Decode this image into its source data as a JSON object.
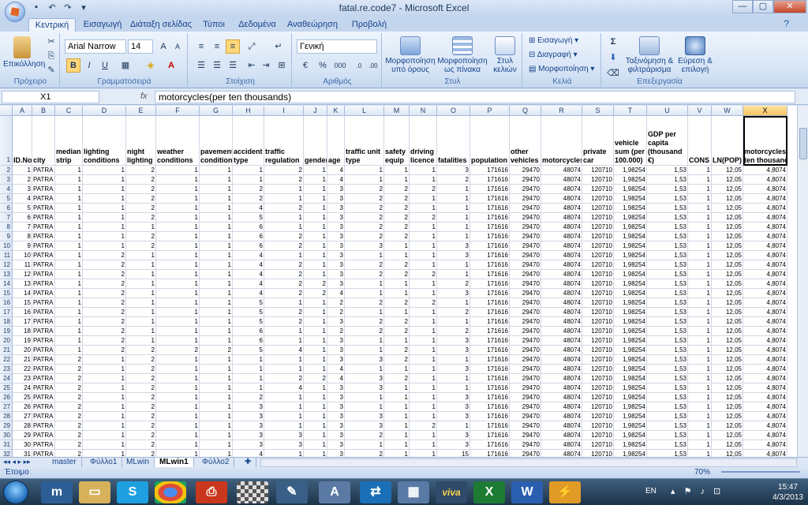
{
  "window": {
    "title": "fatal.re.code7 - Microsoft Excel",
    "minimize": "—",
    "maximize": "▢",
    "close": "✕"
  },
  "tabs": [
    "Κεντρική",
    "Εισαγωγή",
    "Διάταξη σελίδας",
    "Τύποι",
    "Δεδομένα",
    "Αναθεώρηση",
    "Προβολή"
  ],
  "ribbon": {
    "clipboard": {
      "paste": "Επικόλληση",
      "label": "Πρόχειρο"
    },
    "font": {
      "name": "Arial Narrow",
      "size": "14",
      "label": "Γραμματοσειρά",
      "bold": "B",
      "italic": "I",
      "underline": "U"
    },
    "alignment": {
      "label": "Στοίχιση"
    },
    "number": {
      "format": "Γενική",
      "label": "Αριθμός",
      "percent": "%",
      "thousands": "000"
    },
    "styles": {
      "conditional": "Μορφοποίηση υπό όρους",
      "table": "Μορφοποίηση ως πίνακα",
      "cell": "Στυλ κελιών",
      "label": "Στυλ"
    },
    "cells": {
      "insert": "Εισαγωγή",
      "delete": "Διαγραφή",
      "format": "Μορφοποίηση",
      "label": "Κελιά"
    },
    "editing": {
      "sort": "Ταξινόμηση & φιλτράρισμα",
      "find": "Εύρεση & επιλογή",
      "label": "Επεξεργασία"
    }
  },
  "formula_bar": {
    "name_box": "X1",
    "fx": "fx",
    "content": "motorcycles(per ten thousands)"
  },
  "columns": [
    "A",
    "B",
    "C",
    "D",
    "E",
    "F",
    "G",
    "H",
    "I",
    "J",
    "K",
    "L",
    "M",
    "N",
    "O",
    "P",
    "Q",
    "R",
    "S",
    "T",
    "U",
    "V",
    "W",
    "X"
  ],
  "headers": [
    "ID.No",
    "city",
    "median strip",
    "lighting conditions",
    "night lighting",
    "weather conditions",
    "pavement condition",
    "accident type",
    "traffic regulation",
    "gender",
    "age",
    "traffic unit type",
    "safety equip",
    "driving licence",
    "fatalities",
    "population",
    "other vehicles",
    "motorcycles",
    "private car",
    "vehicle sum (per 100.000)",
    "GDP per capita (thousand €)",
    "CONS",
    "LN(POP)",
    "motorcycles(per ten thousands)"
  ],
  "rows": [
    [
      "1",
      "PATRA",
      "1",
      "1",
      "2",
      "1",
      "1",
      "1",
      "2",
      "1",
      "4",
      "1",
      "1",
      "1",
      "3",
      "171616",
      "29470",
      "48074",
      "120710",
      "1,98254",
      "1,53",
      "1",
      "12,05",
      "4,8074"
    ],
    [
      "2",
      "PATRA",
      "1",
      "1",
      "2",
      "1",
      "1",
      "1",
      "2",
      "1",
      "4",
      "1",
      "1",
      "1",
      "2",
      "171616",
      "29470",
      "48074",
      "120710",
      "1,98254",
      "1,53",
      "1",
      "12,05",
      "4,8074"
    ],
    [
      "3",
      "PATRA",
      "1",
      "1",
      "2",
      "1",
      "1",
      "2",
      "1",
      "1",
      "3",
      "2",
      "2",
      "2",
      "1",
      "171616",
      "29470",
      "48074",
      "120710",
      "1,98254",
      "1,53",
      "1",
      "12,05",
      "4,8074"
    ],
    [
      "4",
      "PATRA",
      "1",
      "1",
      "2",
      "1",
      "1",
      "2",
      "1",
      "1",
      "3",
      "2",
      "2",
      "1",
      "1",
      "171616",
      "29470",
      "48074",
      "120710",
      "1,98254",
      "1,53",
      "1",
      "12,05",
      "4,8074"
    ],
    [
      "5",
      "PATRA",
      "1",
      "1",
      "2",
      "1",
      "1",
      "4",
      "2",
      "1",
      "3",
      "2",
      "2",
      "1",
      "1",
      "171616",
      "29470",
      "48074",
      "120710",
      "1,98254",
      "1,53",
      "1",
      "12,05",
      "4,8074"
    ],
    [
      "6",
      "PATRA",
      "1",
      "1",
      "2",
      "1",
      "1",
      "5",
      "1",
      "1",
      "3",
      "2",
      "2",
      "2",
      "1",
      "171616",
      "29470",
      "48074",
      "120710",
      "1,98254",
      "1,53",
      "1",
      "12,05",
      "4,8074"
    ],
    [
      "7",
      "PATRA",
      "1",
      "1",
      "1",
      "1",
      "1",
      "6",
      "1",
      "1",
      "3",
      "2",
      "2",
      "1",
      "1",
      "171616",
      "29470",
      "48074",
      "120710",
      "1,98254",
      "1,53",
      "1",
      "12,05",
      "4,8074"
    ],
    [
      "8",
      "PATRA",
      "1",
      "1",
      "2",
      "1",
      "1",
      "6",
      "2",
      "1",
      "3",
      "2",
      "2",
      "1",
      "1",
      "171616",
      "29470",
      "48074",
      "120710",
      "1,98254",
      "1,53",
      "1",
      "12,05",
      "4,8074"
    ],
    [
      "9",
      "PATRA",
      "1",
      "1",
      "2",
      "1",
      "1",
      "6",
      "2",
      "1",
      "3",
      "3",
      "1",
      "1",
      "3",
      "171616",
      "29470",
      "48074",
      "120710",
      "1,98254",
      "1,53",
      "1",
      "12,05",
      "4,8074"
    ],
    [
      "10",
      "PATRA",
      "1",
      "2",
      "1",
      "1",
      "1",
      "4",
      "1",
      "1",
      "3",
      "1",
      "1",
      "1",
      "3",
      "171616",
      "29470",
      "48074",
      "120710",
      "1,98254",
      "1,53",
      "1",
      "12,05",
      "4,8074"
    ],
    [
      "11",
      "PATRA",
      "1",
      "2",
      "1",
      "1",
      "1",
      "4",
      "2",
      "1",
      "3",
      "2",
      "2",
      "1",
      "1",
      "171616",
      "29470",
      "48074",
      "120710",
      "1,98254",
      "1,53",
      "1",
      "12,05",
      "4,8074"
    ],
    [
      "12",
      "PATRA",
      "1",
      "2",
      "1",
      "1",
      "1",
      "4",
      "2",
      "1",
      "3",
      "2",
      "2",
      "2",
      "1",
      "171616",
      "29470",
      "48074",
      "120710",
      "1,98254",
      "1,53",
      "1",
      "12,05",
      "4,8074"
    ],
    [
      "13",
      "PATRA",
      "1",
      "2",
      "1",
      "1",
      "1",
      "4",
      "2",
      "2",
      "3",
      "1",
      "1",
      "1",
      "2",
      "171616",
      "29470",
      "48074",
      "120710",
      "1,98254",
      "1,53",
      "1",
      "12,05",
      "4,8074"
    ],
    [
      "14",
      "PATRA",
      "1",
      "2",
      "1",
      "1",
      "1",
      "4",
      "2",
      "2",
      "4",
      "1",
      "1",
      "1",
      "3",
      "171616",
      "29470",
      "48074",
      "120710",
      "1,98254",
      "1,53",
      "1",
      "12,05",
      "4,8074"
    ],
    [
      "15",
      "PATRA",
      "1",
      "2",
      "1",
      "1",
      "1",
      "5",
      "1",
      "1",
      "2",
      "2",
      "2",
      "2",
      "1",
      "171616",
      "29470",
      "48074",
      "120710",
      "1,98254",
      "1,53",
      "1",
      "12,05",
      "4,8074"
    ],
    [
      "16",
      "PATRA",
      "1",
      "2",
      "1",
      "1",
      "1",
      "5",
      "2",
      "1",
      "2",
      "1",
      "1",
      "1",
      "2",
      "171616",
      "29470",
      "48074",
      "120710",
      "1,98254",
      "1,53",
      "1",
      "12,05",
      "4,8074"
    ],
    [
      "17",
      "PATRA",
      "1",
      "2",
      "1",
      "1",
      "1",
      "5",
      "2",
      "1",
      "3",
      "2",
      "2",
      "1",
      "1",
      "171616",
      "29470",
      "48074",
      "120710",
      "1,98254",
      "1,53",
      "1",
      "12,05",
      "4,8074"
    ],
    [
      "18",
      "PATRA",
      "1",
      "2",
      "1",
      "1",
      "1",
      "6",
      "1",
      "1",
      "2",
      "2",
      "2",
      "1",
      "2",
      "171616",
      "29470",
      "48074",
      "120710",
      "1,98254",
      "1,53",
      "1",
      "12,05",
      "4,8074"
    ],
    [
      "19",
      "PATRA",
      "1",
      "2",
      "1",
      "1",
      "1",
      "6",
      "1",
      "1",
      "3",
      "1",
      "1",
      "1",
      "3",
      "171616",
      "29470",
      "48074",
      "120710",
      "1,98254",
      "1,53",
      "1",
      "12,05",
      "4,8074"
    ],
    [
      "20",
      "PATRA",
      "1",
      "2",
      "2",
      "2",
      "2",
      "5",
      "4",
      "1",
      "3",
      "1",
      "2",
      "1",
      "3",
      "171616",
      "29470",
      "48074",
      "120710",
      "1,98254",
      "1,53",
      "1",
      "12,05",
      "4,8074"
    ],
    [
      "21",
      "PATRA",
      "2",
      "1",
      "2",
      "1",
      "1",
      "1",
      "1",
      "1",
      "3",
      "3",
      "2",
      "1",
      "1",
      "171616",
      "29470",
      "48074",
      "120710",
      "1,98254",
      "1,53",
      "1",
      "12,05",
      "4,8074"
    ],
    [
      "22",
      "PATRA",
      "2",
      "1",
      "2",
      "1",
      "1",
      "1",
      "1",
      "1",
      "4",
      "1",
      "1",
      "1",
      "3",
      "171616",
      "29470",
      "48074",
      "120710",
      "1,98254",
      "1,53",
      "1",
      "12,05",
      "4,8074"
    ],
    [
      "23",
      "PATRA",
      "2",
      "1",
      "2",
      "1",
      "1",
      "1",
      "2",
      "2",
      "4",
      "3",
      "2",
      "1",
      "1",
      "171616",
      "29470",
      "48074",
      "120710",
      "1,98254",
      "1,53",
      "1",
      "12,05",
      "4,8074"
    ],
    [
      "24",
      "PATRA",
      "2",
      "1",
      "2",
      "1",
      "1",
      "1",
      "4",
      "1",
      "3",
      "3",
      "1",
      "1",
      "1",
      "171616",
      "29470",
      "48074",
      "120710",
      "1,98254",
      "1,53",
      "1",
      "12,05",
      "4,8074"
    ],
    [
      "25",
      "PATRA",
      "2",
      "1",
      "2",
      "1",
      "1",
      "2",
      "1",
      "1",
      "3",
      "1",
      "1",
      "1",
      "3",
      "171616",
      "29470",
      "48074",
      "120710",
      "1,98254",
      "1,53",
      "1",
      "12,05",
      "4,8074"
    ],
    [
      "26",
      "PATRA",
      "2",
      "1",
      "2",
      "1",
      "1",
      "3",
      "1",
      "1",
      "3",
      "1",
      "1",
      "1",
      "3",
      "171616",
      "29470",
      "48074",
      "120710",
      "1,98254",
      "1,53",
      "1",
      "12,05",
      "4,8074"
    ],
    [
      "27",
      "PATRA",
      "2",
      "1",
      "2",
      "1",
      "1",
      "3",
      "1",
      "1",
      "3",
      "3",
      "1",
      "1",
      "3",
      "171616",
      "29470",
      "48074",
      "120710",
      "1,98254",
      "1,53",
      "1",
      "12,05",
      "4,8074"
    ],
    [
      "28",
      "PATRA",
      "2",
      "1",
      "2",
      "1",
      "1",
      "3",
      "1",
      "1",
      "3",
      "3",
      "1",
      "2",
      "1",
      "171616",
      "29470",
      "48074",
      "120710",
      "1,98254",
      "1,53",
      "1",
      "12,05",
      "4,8074"
    ],
    [
      "29",
      "PATRA",
      "2",
      "1",
      "2",
      "1",
      "1",
      "3",
      "3",
      "1",
      "3",
      "2",
      "1",
      "1",
      "3",
      "171616",
      "29470",
      "48074",
      "120710",
      "1,98254",
      "1,53",
      "1",
      "12,05",
      "4,8074"
    ],
    [
      "30",
      "PATRA",
      "2",
      "1",
      "2",
      "1",
      "1",
      "3",
      "3",
      "1",
      "3",
      "1",
      "1",
      "1",
      "3",
      "171616",
      "29470",
      "48074",
      "120710",
      "1,98254",
      "1,53",
      "1",
      "12,05",
      "4,8074"
    ],
    [
      "31",
      "PATRA",
      "2",
      "1",
      "2",
      "1",
      "1",
      "4",
      "1",
      "1",
      "3",
      "2",
      "1",
      "1",
      "15",
      "171616",
      "29470",
      "48074",
      "120710",
      "1,98254",
      "1,53",
      "1",
      "12,05",
      "4,8074"
    ]
  ],
  "sheet_tabs": [
    "master",
    "Φύλλο1",
    "MLwin",
    "MLwin1",
    "Φύλλο2"
  ],
  "active_sheet": "MLwin1",
  "status": {
    "ready": "Έτοιμο",
    "zoom": "70%"
  },
  "tray": {
    "lang": "EN",
    "time": "15:47",
    "date": "4/3/2013"
  }
}
